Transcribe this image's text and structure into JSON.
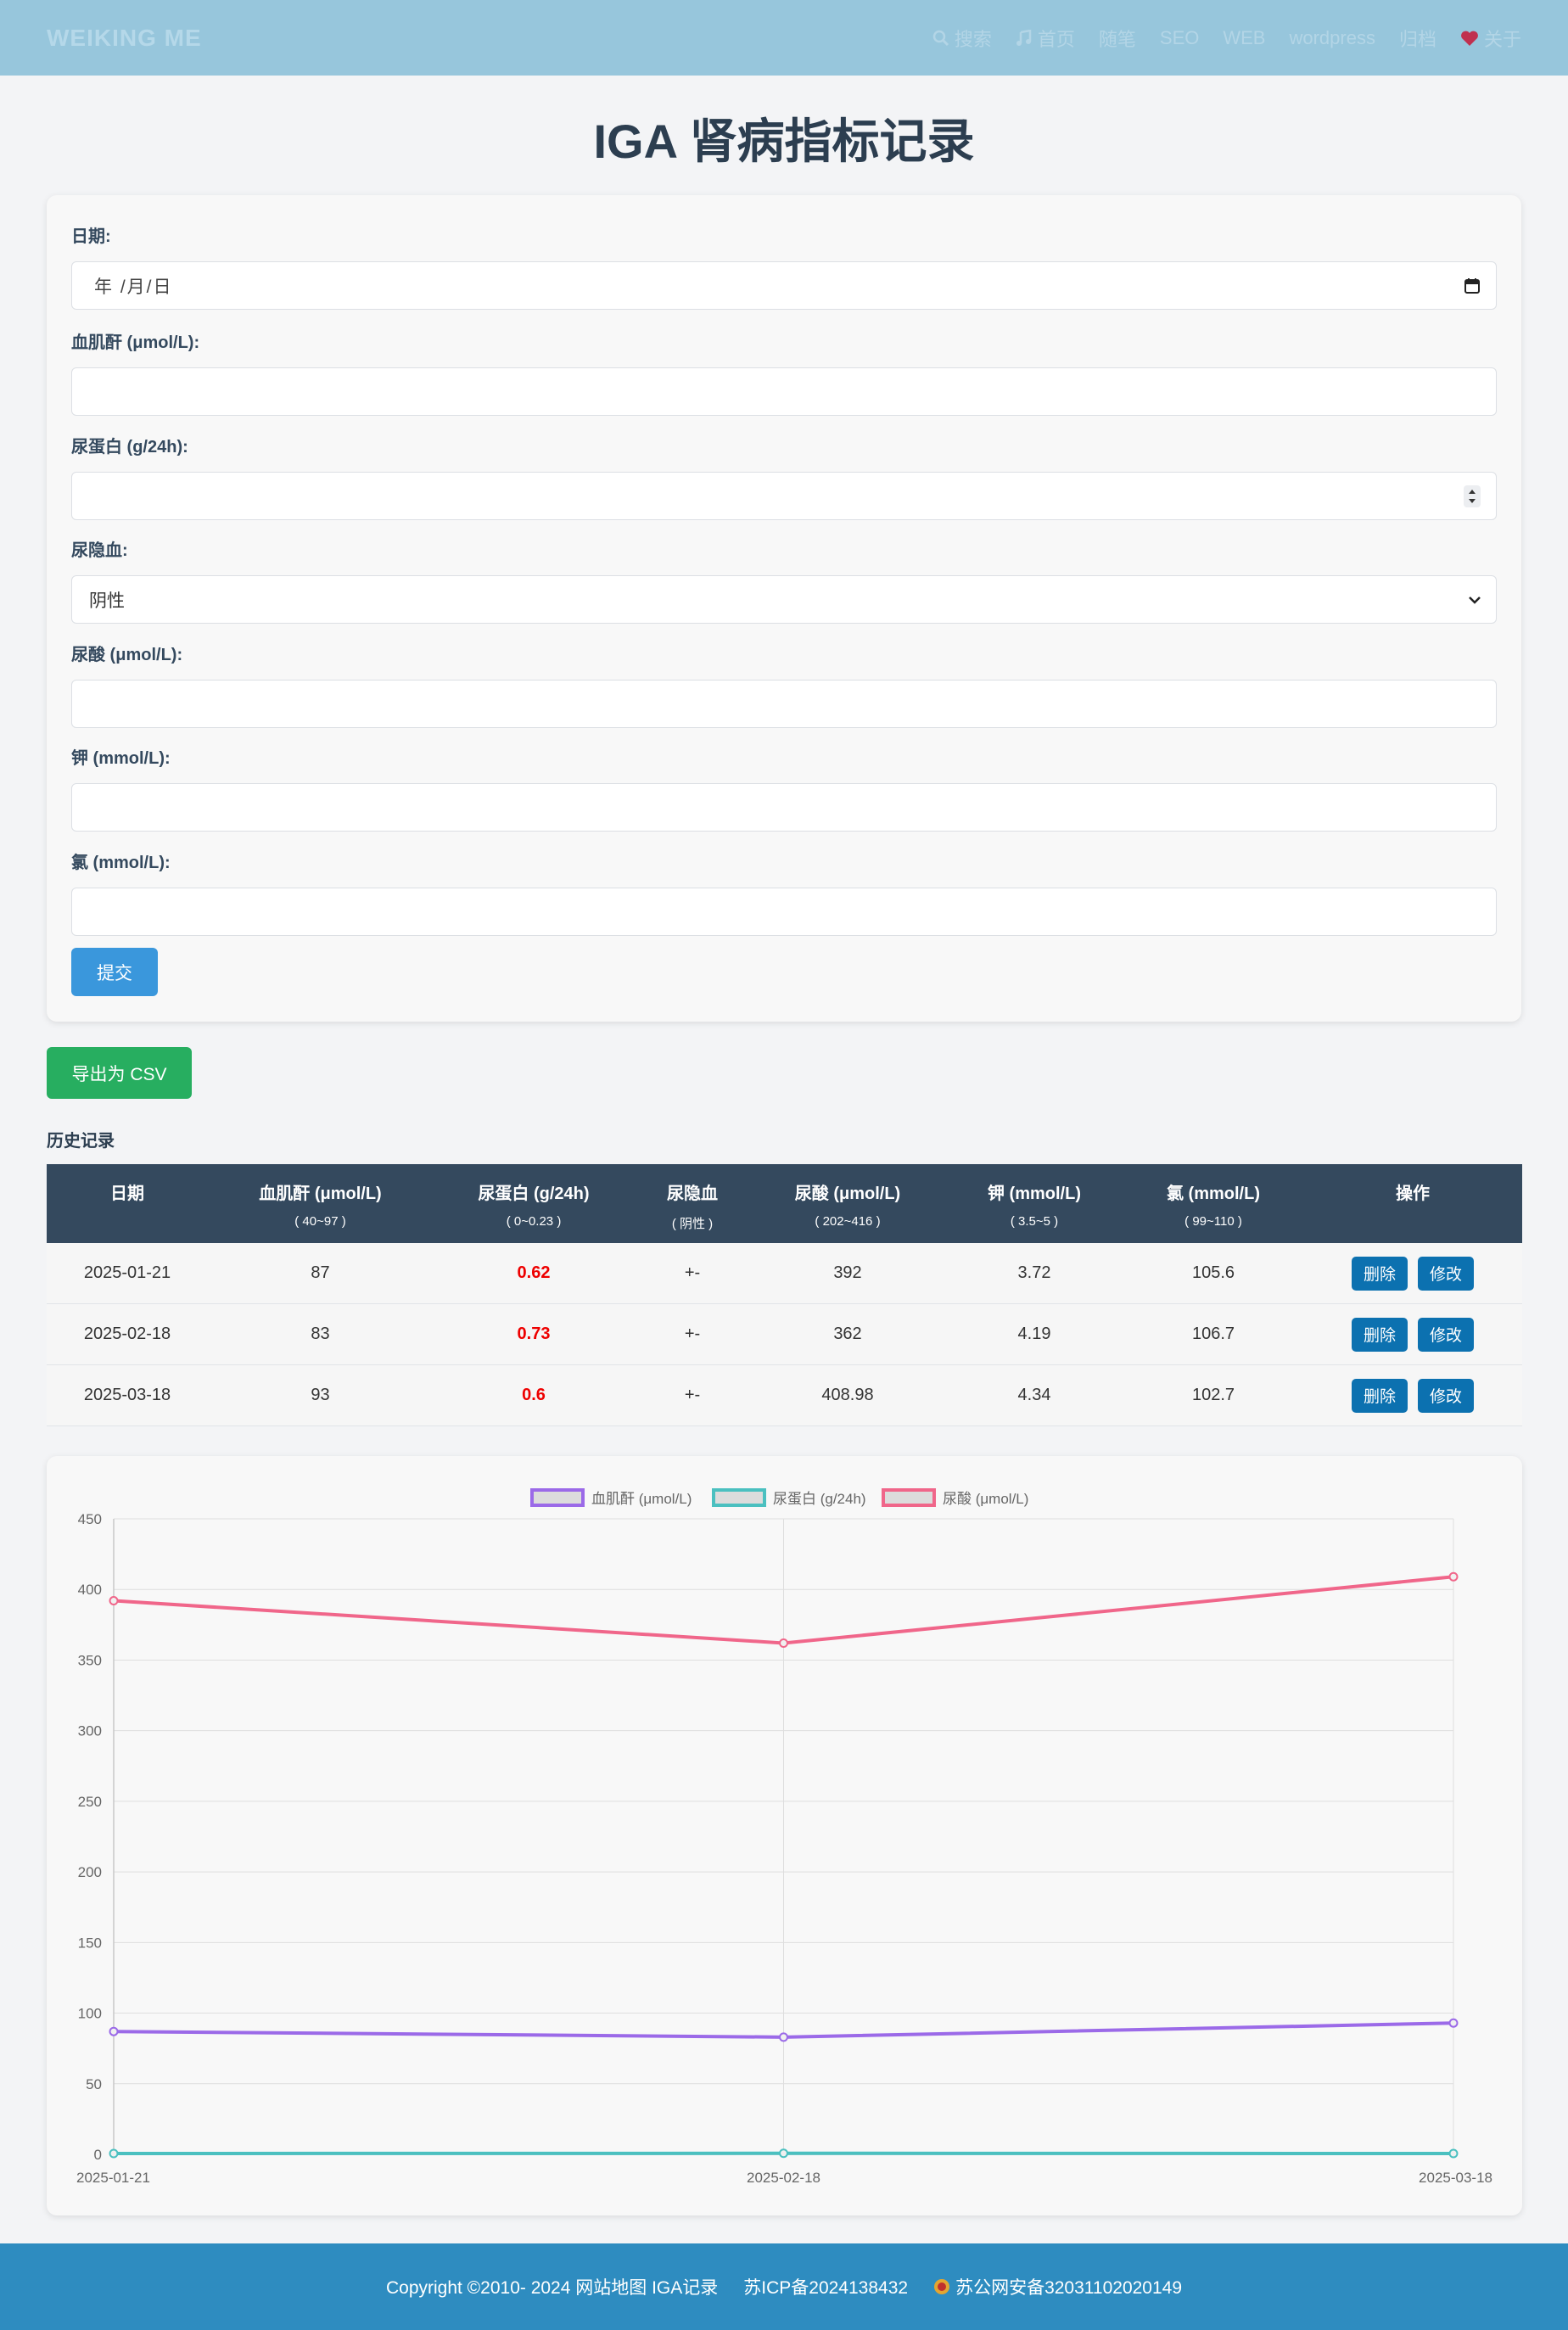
{
  "header": {
    "brand": "WEIKING ME",
    "nav": [
      {
        "label": "搜索",
        "icon": "search-icon"
      },
      {
        "label": "首页",
        "icon": "music-icon"
      },
      {
        "label": "随笔",
        "icon": ""
      },
      {
        "label": "SEO",
        "icon": ""
      },
      {
        "label": "WEB",
        "icon": ""
      },
      {
        "label": "wordpress",
        "icon": ""
      },
      {
        "label": "归档",
        "icon": ""
      },
      {
        "label": "关于",
        "icon": "heart-icon"
      }
    ]
  },
  "page_title": "IGA 肾病指标记录",
  "form": {
    "date": {
      "label": "日期:",
      "placeholder": "年 /月/日"
    },
    "creatinine": {
      "label": "血肌酐 (μmol/L):",
      "value": ""
    },
    "protein": {
      "label": "尿蛋白 (g/24h):",
      "value": ""
    },
    "blood": {
      "label": "尿隐血:",
      "selected": "阴性"
    },
    "uric": {
      "label": "尿酸 (μmol/L):",
      "value": ""
    },
    "potassium": {
      "label": "钾 (mmol/L):",
      "value": ""
    },
    "chlorine": {
      "label": "氯 (mmol/L):",
      "value": ""
    },
    "submit": "提交"
  },
  "export_label": "导出为 CSV",
  "history_title": "历史记录",
  "table": {
    "headers": [
      {
        "name": "日期",
        "range": ""
      },
      {
        "name": "血肌酐 (μmol/L)",
        "range": "( 40~97 )"
      },
      {
        "name": "尿蛋白 (g/24h)",
        "range": "( 0~0.23 )"
      },
      {
        "name": "尿隐血",
        "range": "( 阴性 )"
      },
      {
        "name": "尿酸 (μmol/L)",
        "range": "( 202~416 )"
      },
      {
        "name": "钾 (mmol/L)",
        "range": "( 3.5~5 )"
      },
      {
        "name": "氯 (mmol/L)",
        "range": "( 99~110 )"
      },
      {
        "name": "操作",
        "range": ""
      }
    ],
    "rows": [
      {
        "date": "2025-01-21",
        "creatinine": "87",
        "protein": "0.62",
        "blood": "+-",
        "uric": "392",
        "potassium": "3.72",
        "chlorine": "105.6"
      },
      {
        "date": "2025-02-18",
        "creatinine": "83",
        "protein": "0.73",
        "blood": "+-",
        "uric": "362",
        "potassium": "4.19",
        "chlorine": "106.7"
      },
      {
        "date": "2025-03-18",
        "creatinine": "93",
        "protein": "0.6",
        "blood": "+-",
        "uric": "408.98",
        "potassium": "4.34",
        "chlorine": "102.7"
      }
    ],
    "delete_label": "删除",
    "edit_label": "修改"
  },
  "chart_data": {
    "type": "line",
    "categories": [
      "2025-01-21",
      "2025-02-18",
      "2025-03-18"
    ],
    "series": [
      {
        "name": "血肌酐 (μmol/L)",
        "values": [
          87,
          83,
          93
        ],
        "color": "#9b6ae8"
      },
      {
        "name": "尿蛋白 (g/24h)",
        "values": [
          0.62,
          0.73,
          0.6
        ],
        "color": "#4bc0c0"
      },
      {
        "name": "尿酸 (μmol/L)",
        "values": [
          392,
          362,
          408.98
        ],
        "color": "#f0668a"
      }
    ],
    "ylim": [
      0,
      450
    ],
    "yticks": [
      "0",
      "50",
      "100",
      "150",
      "200",
      "250",
      "300",
      "350",
      "400",
      "450"
    ],
    "grid": true,
    "legend": "top-center"
  },
  "footer": {
    "copyright": "Copyright ©2010- 2024 网站地图 IGA记录",
    "icp": "苏ICP备2024138432",
    "police": "苏公网安备32031102020149"
  },
  "colors": {
    "header_bg": "#97c6dc",
    "footer_bg": "#2e8cc0",
    "submit": "#3a97dc",
    "export": "#27ae60",
    "table_head": "#34495e",
    "action_button": "#0c71b0",
    "abnormal": "#e00000"
  }
}
